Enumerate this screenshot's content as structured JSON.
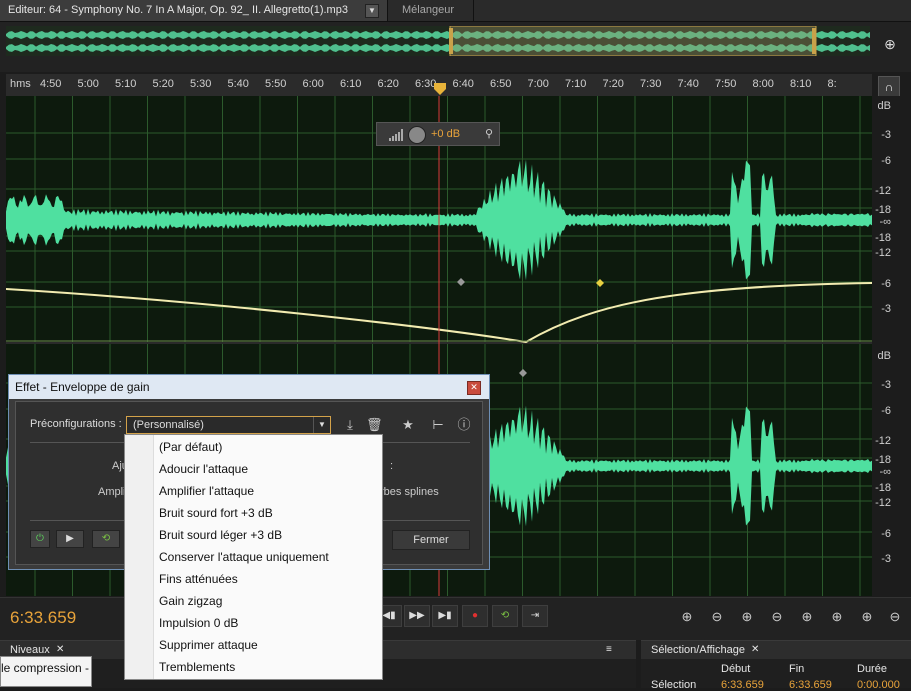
{
  "tabs": {
    "editor": "Editeur: 64 - Symphony No. 7 In A Major, Op. 92_ II. Allegretto(1).mp3",
    "mixer": "Mélangeur"
  },
  "ruler": {
    "unit": "hms",
    "ticks": [
      "4:50",
      "5:00",
      "5:10",
      "5:20",
      "5:30",
      "5:40",
      "5:50",
      "6:00",
      "6:10",
      "6:20",
      "6:30",
      "6:40",
      "6:50",
      "7:00",
      "7:10",
      "7:20",
      "7:30",
      "7:40",
      "7:50",
      "8:00",
      "8:10",
      "8:"
    ]
  },
  "db_scale": {
    "top": [
      "dB",
      "-3",
      "-6",
      "-12",
      "-18",
      "-∞",
      "-18",
      "-12",
      "-6",
      "-3"
    ],
    "bottom": [
      "dB",
      "-3",
      "-6",
      "-12",
      "-18",
      "-∞",
      "-18",
      "-12",
      "-6",
      "-3"
    ]
  },
  "hud": {
    "gain": "+0 dB"
  },
  "colors": {
    "waveform": "#4fe0a0",
    "envelope": "#f2ebb0",
    "playhead": "#d63a3a",
    "accent": "#e8a33a",
    "grid": "#2c5a2c"
  },
  "dialog": {
    "title": "Effet - Enveloppe de gain",
    "preset_label": "Préconfigurations :",
    "preset_value": "(Personnalisé)",
    "partial_1": "Aju",
    "partial_2": "Ampli",
    "partial_3": ":",
    "partial_4": "rbes splines",
    "close_button": "Fermer"
  },
  "preset_options": [
    "(Par défaut)",
    "Adoucir l'attaque",
    "Amplifier l'attaque",
    "Bruit sourd fort +3 dB",
    "Bruit sourd léger +3 dB",
    "Conserver l'attaque uniquement",
    "Fins atténuées",
    "Gain zigzag",
    "Impulsion 0 dB",
    "Supprimer attaque",
    "Tremblements"
  ],
  "transport": {
    "timecode": "6:33.659"
  },
  "panels": {
    "levels_title": "Niveaux",
    "selection_title": "Sélection/Affichage",
    "sel_cols": [
      "Début",
      "Fin",
      "Durée"
    ],
    "sel_row_label": "Sélection",
    "sel_values": [
      "6:33.659",
      "6:33.659",
      "0:00.000"
    ]
  },
  "tooltip": "le compression -"
}
